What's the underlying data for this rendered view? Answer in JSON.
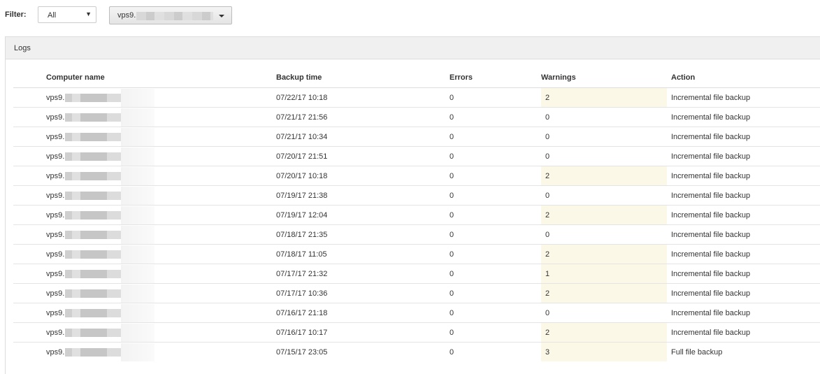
{
  "filter": {
    "label": "Filter:",
    "status_select": {
      "value": "All",
      "caret": "▼"
    },
    "computer_select": {
      "value": "vps9."
    }
  },
  "panel": {
    "title": "Logs"
  },
  "table": {
    "headers": [
      "Computer name",
      "Backup time",
      "Errors",
      "Warnings",
      "Action"
    ],
    "rows": [
      {
        "computer": "vps9.",
        "time": "07/22/17 10:18",
        "errors": "0",
        "warnings": "2",
        "action": "Incremental file backup",
        "highlight": true
      },
      {
        "computer": "vps9.",
        "time": "07/21/17 21:56",
        "errors": "0",
        "warnings": "0",
        "action": "Incremental file backup",
        "highlight": false
      },
      {
        "computer": "vps9.",
        "time": "07/21/17 10:34",
        "errors": "0",
        "warnings": "0",
        "action": "Incremental file backup",
        "highlight": false
      },
      {
        "computer": "vps9.",
        "time": "07/20/17 21:51",
        "errors": "0",
        "warnings": "0",
        "action": "Incremental file backup",
        "highlight": false
      },
      {
        "computer": "vps9.",
        "time": "07/20/17 10:18",
        "errors": "0",
        "warnings": "2",
        "action": "Incremental file backup",
        "highlight": true
      },
      {
        "computer": "vps9.",
        "time": "07/19/17 21:38",
        "errors": "0",
        "warnings": "0",
        "action": "Incremental file backup",
        "highlight": false
      },
      {
        "computer": "vps9.",
        "time": "07/19/17 12:04",
        "errors": "0",
        "warnings": "2",
        "action": "Incremental file backup",
        "highlight": true
      },
      {
        "computer": "vps9.",
        "time": "07/18/17 21:35",
        "errors": "0",
        "warnings": "0",
        "action": "Incremental file backup",
        "highlight": false
      },
      {
        "computer": "vps9.",
        "time": "07/18/17 11:05",
        "errors": "0",
        "warnings": "2",
        "action": "Incremental file backup",
        "highlight": true
      },
      {
        "computer": "vps9.",
        "time": "07/17/17 21:32",
        "errors": "0",
        "warnings": "1",
        "action": "Incremental file backup",
        "highlight": true
      },
      {
        "computer": "vps9.",
        "time": "07/17/17 10:36",
        "errors": "0",
        "warnings": "2",
        "action": "Incremental file backup",
        "highlight": true
      },
      {
        "computer": "vps9.",
        "time": "07/16/17 21:18",
        "errors": "0",
        "warnings": "0",
        "action": "Incremental file backup",
        "highlight": false
      },
      {
        "computer": "vps9.",
        "time": "07/16/17 10:17",
        "errors": "0",
        "warnings": "2",
        "action": "Incremental file backup",
        "highlight": true
      },
      {
        "computer": "vps9.",
        "time": "07/15/17 23:05",
        "errors": "0",
        "warnings": "3",
        "action": "Full file backup",
        "highlight": true
      }
    ]
  },
  "colors": {
    "warning_highlight": "#fcf8e8",
    "panel_header_bg": "#f0f0f0",
    "border": "#dddddd"
  }
}
